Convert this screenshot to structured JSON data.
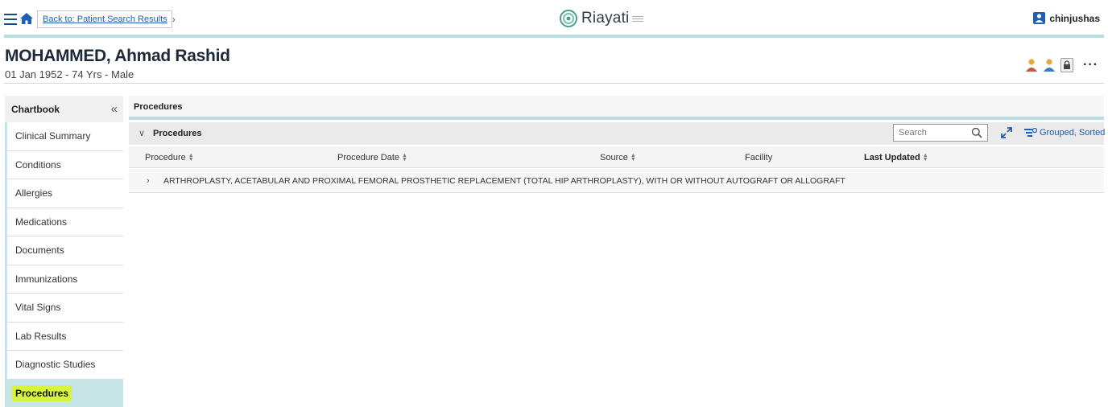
{
  "topbar": {
    "back_link": "Back to: Patient Search Results",
    "brand": "Riayati",
    "user": "chinjushas",
    "accent_color": "#b8dde0",
    "link_color": "#1f5fb5"
  },
  "patient": {
    "name": "MOHAMMED, Ahmad Rashid",
    "info": "01 Jan 1952 - 74 Yrs - Male"
  },
  "sidebar": {
    "title": "Chartbook",
    "items": [
      {
        "label": "Clinical Summary"
      },
      {
        "label": "Conditions"
      },
      {
        "label": "Allergies"
      },
      {
        "label": "Medications"
      },
      {
        "label": "Documents"
      },
      {
        "label": "Immunizations"
      },
      {
        "label": "Vital Signs"
      },
      {
        "label": "Lab Results"
      },
      {
        "label": "Diagnostic Studies"
      },
      {
        "label": "Procedures",
        "active": true
      }
    ]
  },
  "main": {
    "title": "Procedures",
    "section_title": "Procedures",
    "search_placeholder": "Search",
    "grouped_label": "Grouped, Sorted",
    "columns": {
      "procedure": "Procedure",
      "procedure_date": "Procedure Date",
      "source": "Source",
      "facility": "Facility",
      "last_updated": "Last Updated"
    },
    "rows": [
      {
        "text": "ARTHROPLASTY, ACETABULAR AND PROXIMAL FEMORAL PROSTHETIC REPLACEMENT (TOTAL HIP ARTHROPLASTY), WITH OR WITHOUT AUTOGRAFT OR ALLOGRAFT"
      }
    ]
  }
}
